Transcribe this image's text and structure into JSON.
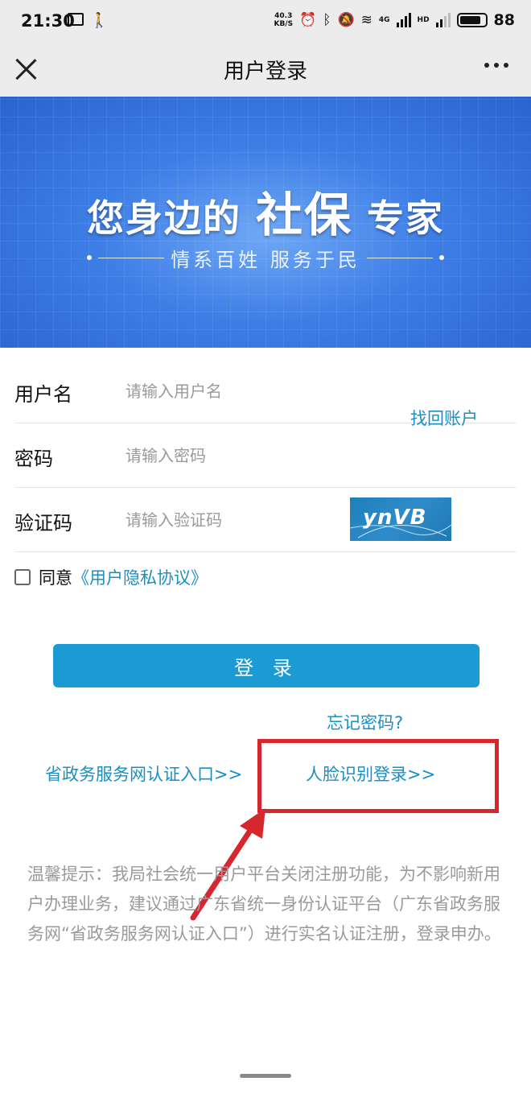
{
  "status_bar": {
    "time": "21:30",
    "net_speed_value": "40.3",
    "net_speed_unit": "KB/S",
    "network_type": "4G",
    "hd_label": "HD",
    "battery": "88"
  },
  "header": {
    "title": "用户登录"
  },
  "banner": {
    "headline_a": "您身边的",
    "headline_b": "社保",
    "headline_c": "专家",
    "subline": "情系百姓  服务于民"
  },
  "form": {
    "username": {
      "label": "用户名",
      "placeholder": "请输入用户名",
      "value": ""
    },
    "recover_link": "找回账户",
    "password": {
      "label": "密码",
      "placeholder": "请输入密码",
      "value": ""
    },
    "captcha": {
      "label": "验证码",
      "placeholder": "请输入验证码",
      "value": "",
      "image_text": "ynVB"
    },
    "agree_text": "同意",
    "agree_link": "《用户隐私协议》",
    "agree_checked": false
  },
  "actions": {
    "login_label": "登 录",
    "forgot_password": "忘记密码?",
    "gov_portal_link": "省政务服务网认证入口>>",
    "face_login_link": "人脸识别登录>>"
  },
  "annotation": {
    "highlight_color": "#d8262f"
  },
  "notice": {
    "text": "温馨提示：我局社会统一用户平台关闭注册功能，为不影响新用户办理业务，建议通过广东省统一身份认证平台（广东省政务服务网“省政务服务网认证入口”）进行实名认证注册，登录申办。"
  },
  "colors": {
    "accent": "#1c9ad4",
    "link": "#1a8fc4",
    "banner_blue": "#3d7ee6"
  }
}
